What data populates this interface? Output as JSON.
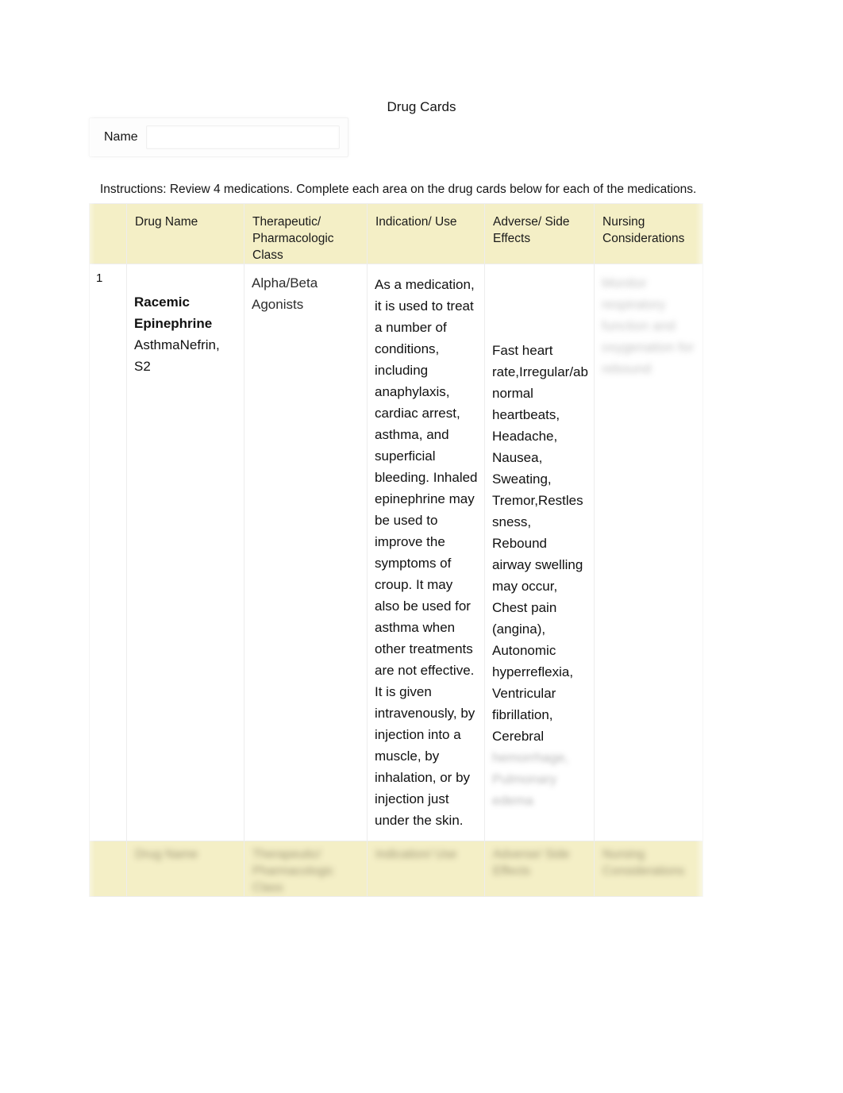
{
  "document": {
    "title": "Drug Cards",
    "instructions": "Instructions: Review 4 medications.  Complete each area on the drug cards below for each of the medications."
  },
  "name_field": {
    "label": "Name",
    "value": "",
    "placeholder": ""
  },
  "table": {
    "headers": {
      "number": "",
      "drug_name": "Drug Name",
      "class": "Therapeutic/ Pharmacologic Class",
      "indication": "Indication/ Use",
      "adverse": "Adverse/ Side Effects",
      "nursing": "Nursing Considerations"
    },
    "rows": [
      {
        "number": "1",
        "drug_name_generic": "Racemic Epinephrine",
        "drug_name_brand": "AsthmaNefrin, S2",
        "class": "Alpha/Beta Agonists",
        "indication": "As a medication, it is used to treat a number of conditions, including anaphylaxis, cardiac arrest, asthma, and superficial bleeding. Inhaled epinephrine may be used to improve the symptoms of croup. It may also be used for asthma when other treatments are not effective. It is given intravenously, by injection into a muscle, by inhalation, or by injection just under the skin.",
        "adverse": "Fast heart rate,Irregular/abnormal heartbeats, Headache, Nausea, Sweating, Tremor,Restlessness, Rebound airway swelling may occur, Chest pain (angina), Autonomic hyperreflexia, Ventricular fibrillation, Cerebral",
        "adverse_redacted": "hemorrhage, Pulmonary edema",
        "nursing_redacted": "Monitor respiratory function and oxygenation for rebound"
      }
    ],
    "footer_headers": {
      "number": "",
      "drug_name": "Drug Name",
      "class": "Therapeutic/ Pharmacologic Class",
      "indication": "Indication/ Use",
      "adverse": "Adverse/ Side Effects",
      "nursing": "Nursing Considerations"
    }
  },
  "colors": {
    "header_background": "#f4efc6",
    "page_background": "#ffffff",
    "text": "#111111",
    "border": "#ededed"
  }
}
